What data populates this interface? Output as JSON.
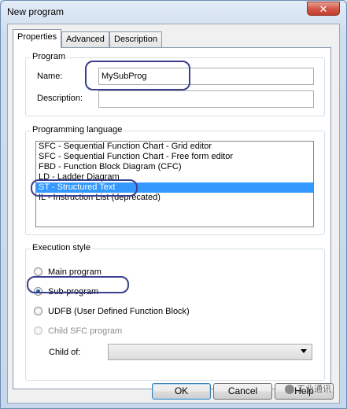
{
  "window": {
    "title": "New program",
    "close_icon": "close-icon"
  },
  "tabs": [
    {
      "label": "Properties",
      "active": true
    },
    {
      "label": "Advanced",
      "active": false
    },
    {
      "label": "Description",
      "active": false
    }
  ],
  "program": {
    "legend": "Program",
    "name_label": "Name:",
    "name_value": "MySubProg",
    "description_label": "Description:",
    "description_value": ""
  },
  "language": {
    "legend": "Programming language",
    "items": [
      "SFC - Sequential Function Chart - Grid editor",
      "SFC - Sequential Function Chart - Free form editor",
      "FBD - Function Block Diagram (CFC)",
      "LD - Ladder Diagram",
      "ST - Structured Text",
      "IL - Instruction List (deprecated)"
    ],
    "selected": "ST - Structured Text"
  },
  "execution": {
    "legend": "Execution style",
    "options": [
      {
        "label": "Main program",
        "checked": false,
        "enabled": true
      },
      {
        "label": "Sub-program",
        "checked": true,
        "enabled": true
      },
      {
        "label": "UDFB (User Defined Function Block)",
        "checked": false,
        "enabled": true
      },
      {
        "label": "Child SFC program",
        "checked": false,
        "enabled": false
      }
    ],
    "child_of_label": "Child of:",
    "child_of_value": ""
  },
  "buttons": {
    "ok": "OK",
    "cancel": "Cancel",
    "help": "Help"
  },
  "watermark": {
    "text": "工业通讯"
  },
  "colors": {
    "selection": "#3399ff",
    "annotation_ring": "#3a3f8e",
    "close_button": "#c33d2d"
  }
}
